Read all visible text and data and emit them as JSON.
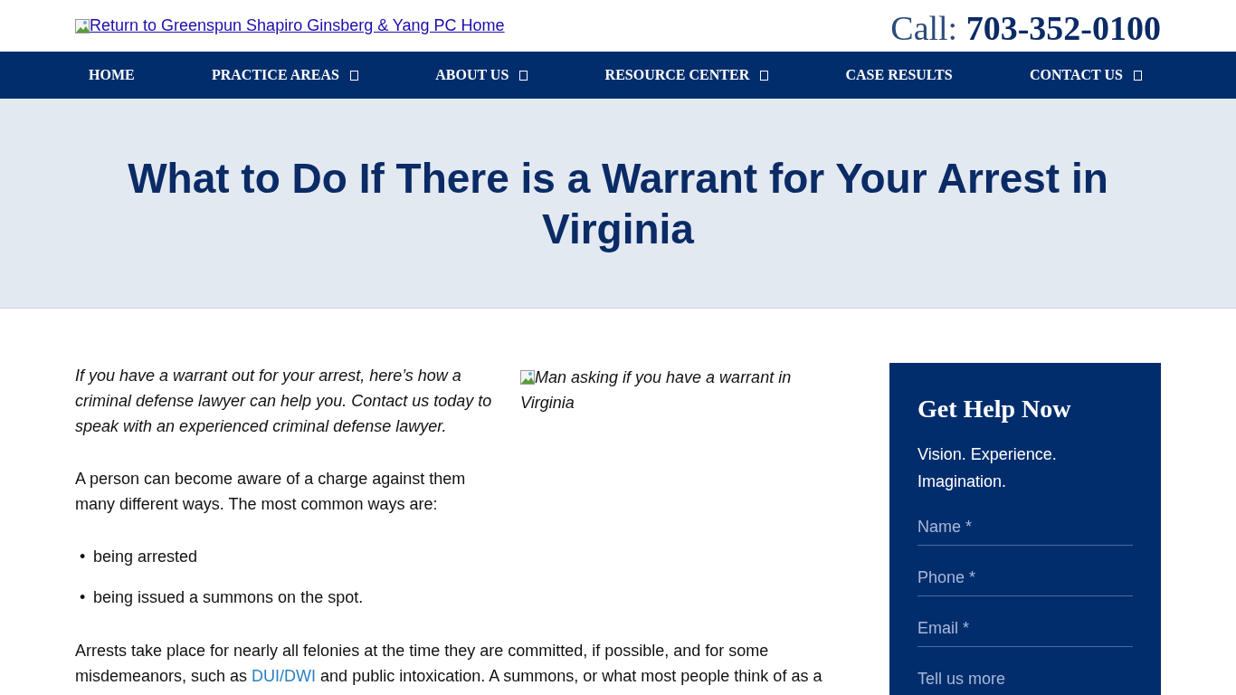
{
  "header": {
    "logo_link": "Return to Greenspun Shapiro Ginsberg & Yang PC Home",
    "call_label": "Call:",
    "phone": "703-352-0100"
  },
  "nav": [
    {
      "label": "HOME",
      "has_dropdown": false
    },
    {
      "label": "PRACTICE AREAS",
      "has_dropdown": true
    },
    {
      "label": "ABOUT US",
      "has_dropdown": true
    },
    {
      "label": "RESOURCE CENTER",
      "has_dropdown": true
    },
    {
      "label": "CASE RESULTS",
      "has_dropdown": false
    },
    {
      "label": "CONTACT US",
      "has_dropdown": true
    }
  ],
  "hero": {
    "title": "What to Do If There is a Warrant for Your Arrest in Virginia"
  },
  "article": {
    "intro": "If you have a warrant out for your arrest, here’s how a criminal defense lawyer can help you. Contact us today to speak with an experienced criminal defense lawyer.",
    "image_alt": "Man asking if you have a warrant in Virginia",
    "paragraph_1": "A person can become aware of a charge against them many different ways.  The most common ways are:",
    "bullet_marker": "•",
    "bullets": [
      "being arrested",
      "being issued a summons on the spot."
    ],
    "paragraph_2": {
      "before": "Arrests take place for nearly all felonies at the time they are committed, if possible, and for some misdemeanors, such as ",
      "link": "DUI/DWI",
      "after": " and public intoxication. A summons, or what most people think of as a"
    }
  },
  "sidebar": {
    "title": "Get Help Now",
    "tagline": "Vision. Experience. Imagination.",
    "fields": [
      {
        "placeholder": "Name *"
      },
      {
        "placeholder": "Phone *"
      },
      {
        "placeholder": "Email *"
      },
      {
        "placeholder": "Tell us more"
      }
    ]
  }
}
